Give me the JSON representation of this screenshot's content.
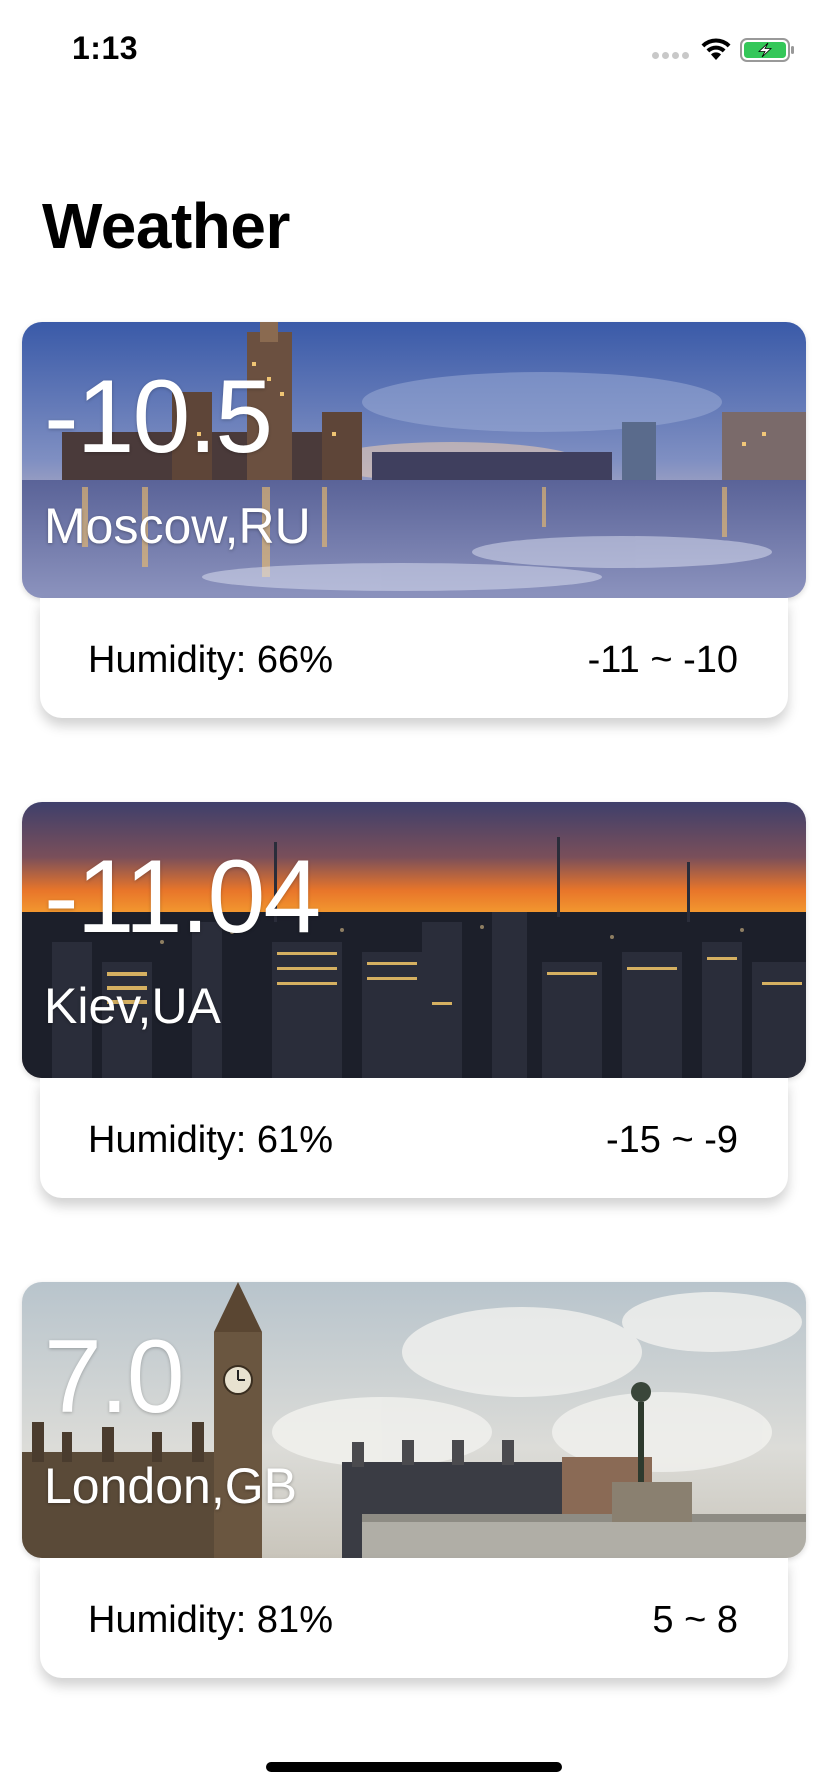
{
  "status_bar": {
    "time": "1:13",
    "signal_icon": "cellular-signal-dots-icon",
    "wifi_icon": "wifi-icon",
    "battery_icon": "battery-charging-icon",
    "battery_color": "#34c759"
  },
  "header": {
    "title": "Weather"
  },
  "cities": [
    {
      "temperature": "-10.5",
      "city": "Moscow,RU",
      "humidity": "Humidity: 66%",
      "range": "-11 ~ -10",
      "image": "moscow-river-night-photo"
    },
    {
      "temperature": "-11.04",
      "city": "Kiev,UA",
      "humidity": "Humidity: 61%",
      "range": "-15 ~ -9",
      "image": "city-skyline-sunset-photo"
    },
    {
      "temperature": "7.0",
      "city": "London,GB",
      "humidity": "Humidity: 81%",
      "range": "5 ~ 8",
      "image": "london-big-ben-photo"
    }
  ]
}
